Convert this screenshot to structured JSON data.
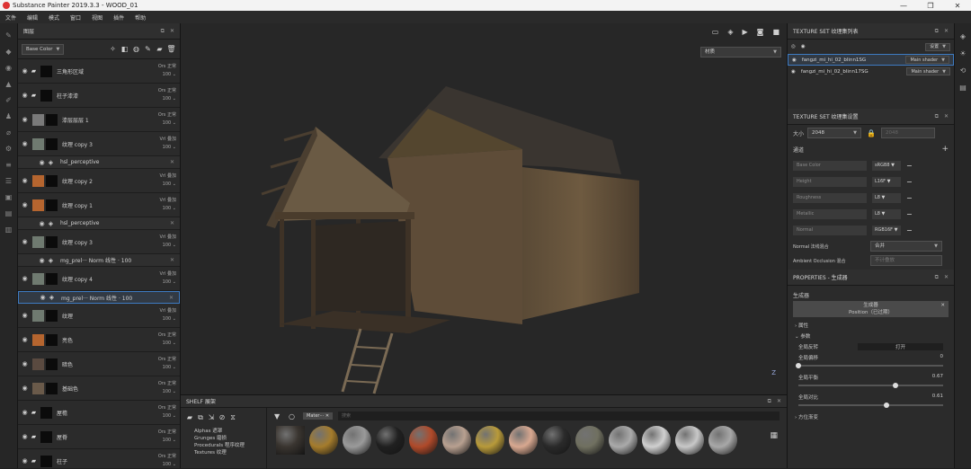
{
  "window": {
    "title": "Substance Painter 2019.3.3 - WOOD_01",
    "min": "—",
    "max": "❐",
    "close": "✕"
  },
  "menu": [
    "文件",
    "编辑",
    "模式",
    "窗口",
    "视图",
    "插件",
    "帮助"
  ],
  "layers_panel": {
    "title": "图层",
    "channel": "Base Color",
    "layers": [
      {
        "kind": "folder",
        "name": "三角形区域",
        "blend": "Ors 正常",
        "opacity": "100"
      },
      {
        "kind": "folder",
        "name": "柱子漆漆",
        "blend": "Ors 正常",
        "opacity": "100"
      },
      {
        "kind": "layer",
        "name": "漆层层层 1",
        "blend": "Ors 正常",
        "opacity": "100",
        "thumb": "#7a7a7a"
      },
      {
        "kind": "layer",
        "name": "纹理 copy 3",
        "blend": "Vrl 叠加",
        "opacity": "100",
        "thumb": "#6f7a70"
      },
      {
        "kind": "sub",
        "name": "hsl_perceptive"
      },
      {
        "kind": "layer",
        "name": "纹理 copy 2",
        "blend": "Vrl 叠加",
        "opacity": "100",
        "thumb": "#b5652f"
      },
      {
        "kind": "layer",
        "name": "纹理 copy 1",
        "blend": "Vrl 叠加",
        "opacity": "100",
        "thumb": "#b5652f"
      },
      {
        "kind": "sub",
        "name": "hsl_perceptive"
      },
      {
        "kind": "layer",
        "name": "纹理 copy 3",
        "blend": "Vrl 叠加",
        "opacity": "100",
        "thumb": "#6f7a70"
      },
      {
        "kind": "sub",
        "name": "mg_prel···  Norm 线性 · 100"
      },
      {
        "kind": "layer",
        "name": "纹理 copy 4",
        "blend": "Vrl 叠加",
        "opacity": "100",
        "thumb": "#6f7a70"
      },
      {
        "kind": "subsel",
        "name": "mg_prel···  Norm 线性 · 100"
      },
      {
        "kind": "layer",
        "name": "纹理",
        "blend": "Vrl 叠加",
        "opacity": "100",
        "thumb": "#6f7a70"
      },
      {
        "kind": "layer",
        "name": "亮色",
        "blend": "Ors 正常",
        "opacity": "100",
        "thumb": "#b5652f"
      },
      {
        "kind": "layer",
        "name": "暗色",
        "blend": "Ors 正常",
        "opacity": "100",
        "thumb": "#5a4a40"
      },
      {
        "kind": "layer",
        "name": "基础色",
        "blend": "Ors 正常",
        "opacity": "100",
        "thumb": "#6a5a4a"
      },
      {
        "kind": "folder",
        "name": "屋檐",
        "blend": "Ors 正常",
        "opacity": "100"
      },
      {
        "kind": "folder",
        "name": "屋脊",
        "blend": "Ors 正常",
        "opacity": "100"
      },
      {
        "kind": "folder",
        "name": "柱子",
        "blend": "Ors 正常",
        "opacity": "100"
      }
    ]
  },
  "viewport": {
    "mode": "材质",
    "axis": "Z"
  },
  "shelf": {
    "title": "SHELF 展架",
    "categories": [
      "Alphas 遮罩",
      "Grunges 磨损",
      "Procedurals 程序纹理",
      "Textures 纹理"
    ],
    "filter_chip": "Mater··· ✕",
    "search_placeholder": "搜索",
    "balls": [
      "#3a3530",
      "#a57c2c",
      "#9a9a9a",
      "#202020",
      "#b04a2a",
      "#b8a090",
      "#b89a3a",
      "#d8a890",
      "#2a2a2a",
      "#707060",
      "#aaaaaa",
      "#d0d0d0",
      "#c8c8c8",
      "#a8a8a8"
    ]
  },
  "texture_list": {
    "title": "TEXTURE SET 纹理集列表",
    "settings": "设置",
    "sets": [
      {
        "name": "fangzi_mi_hi_02_blinn1SG",
        "shader": "Main shader"
      },
      {
        "name": "fangzi_mi_hi_02_blinn17SG",
        "shader": "Main shader"
      }
    ]
  },
  "texture_settings": {
    "title": "TEXTURE SET 纹理集设置",
    "size_label": "大小",
    "size": "2048",
    "size2": "2048",
    "channels_label": "通道",
    "channels": [
      {
        "name": "Base Color",
        "format": "sRGB8"
      },
      {
        "name": "Height",
        "format": "L16F"
      },
      {
        "name": "Roughness",
        "format": "L8"
      },
      {
        "name": "Metallic",
        "format": "L8"
      },
      {
        "name": "Normal",
        "format": "RGB16F"
      }
    ],
    "normal_mix_label": "Normal 法线混合",
    "normal_mix": "合并",
    "ao_label": "Ambient Occlusion 混合",
    "ao": "不计叠放"
  },
  "properties": {
    "title": "PROPERTIES - 生成器",
    "section": "生成器",
    "generator": "生成器",
    "generator_sub": "Position（已过期）",
    "attr_label": "属性",
    "params_label": "参数",
    "global_invert": "全局反转",
    "global_invert_value": "打开",
    "global_balance": "全局偏移",
    "global_balance_value": "0",
    "global_balance_pos": 0,
    "global_contrast": "全局平衡",
    "global_contrast_value": "0.67",
    "global_contrast_pos": 0.67,
    "global_contrast2": "全局对比",
    "global_contrast2_value": "0.61",
    "global_contrast2_pos": 0.61,
    "direction_label": "方位渐变"
  },
  "colors": {
    "accent": "#3e7bc2",
    "bg": "#1f1f1f"
  }
}
